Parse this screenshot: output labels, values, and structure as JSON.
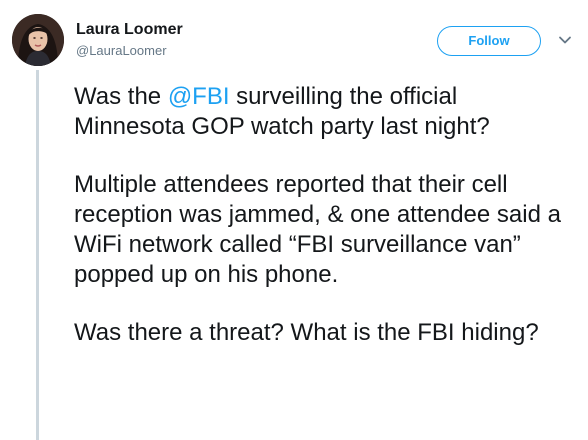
{
  "author": {
    "display_name": "Laura Loomer",
    "handle": "@LauraLoomer"
  },
  "follow_label": "Follow",
  "tweet": {
    "p1_before": "Was the ",
    "p1_mention": "@FBI",
    "p1_after": " surveilling the official Minnesota GOP watch party last night?",
    "p2": "Multiple attendees reported that their cell reception was jammed, & one attendee said a WiFi network called “FBI surveillance van” popped up on his phone.",
    "p3": "Was there a threat? What is the FBI hiding?"
  },
  "colors": {
    "accent": "#1da1f2",
    "text": "#14171a",
    "secondary_text": "#657786",
    "thread_line": "#ccd6dd"
  },
  "icons": {
    "more": "chevron-down-icon",
    "avatar": "profile-photo"
  }
}
